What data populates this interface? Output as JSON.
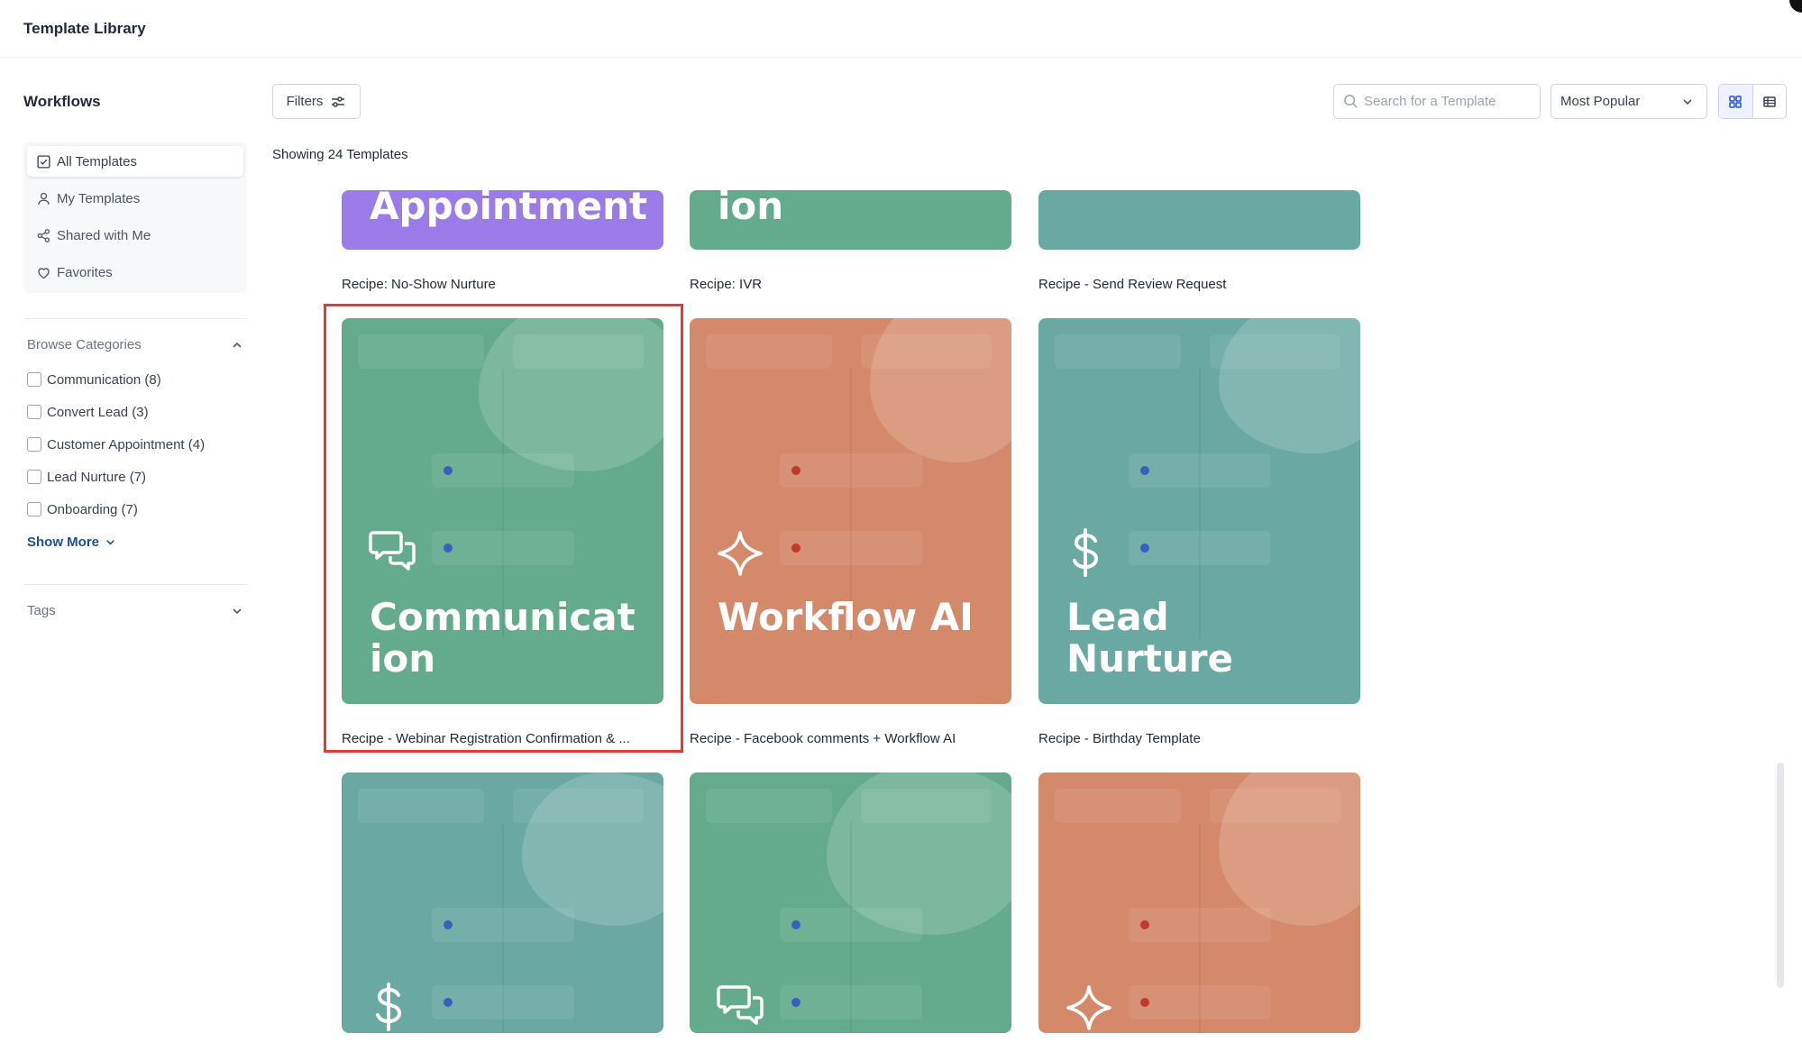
{
  "header": {
    "title": "Template Library"
  },
  "sidebar": {
    "title": "Workflows",
    "nav": [
      {
        "label": "All Templates",
        "icon": "check-square-icon",
        "active": true
      },
      {
        "label": "My Templates",
        "icon": "user-icon",
        "active": false
      },
      {
        "label": "Shared with Me",
        "icon": "share-icon",
        "active": false
      },
      {
        "label": "Favorites",
        "icon": "heart-icon",
        "active": false
      }
    ],
    "browse_categories": {
      "title": "Browse Categories",
      "items": [
        {
          "label": "Communication (8)",
          "checked": false
        },
        {
          "label": "Convert Lead (3)",
          "checked": false
        },
        {
          "label": "Customer Appointment (4)",
          "checked": false
        },
        {
          "label": "Lead Nurture (7)",
          "checked": false
        },
        {
          "label": "Onboarding (7)",
          "checked": false
        }
      ],
      "show_more": "Show More"
    },
    "tags": {
      "title": "Tags"
    }
  },
  "toolbar": {
    "filters_label": "Filters",
    "search_placeholder": "Search for a Template",
    "sort_value": "Most Popular",
    "view_modes": [
      "grid",
      "list"
    ],
    "active_view": "grid"
  },
  "results": {
    "showing_label": "Showing 24 Templates"
  },
  "cards": [
    {
      "title": "Appointment",
      "label": "Recipe: No-Show Nurture",
      "color": "#9b7be8",
      "icon": ""
    },
    {
      "title": "ion",
      "label": "Recipe: IVR",
      "color": "#63ab8c",
      "icon": ""
    },
    {
      "title": "",
      "label": "Recipe - Send Review Request",
      "color": "#6aa9a2",
      "icon": ""
    },
    {
      "title": "Communicat ion",
      "label": "Recipe - Webinar Registration Confirmation & ...",
      "color": "#63ab8c",
      "icon": "chat-bubbles-icon"
    },
    {
      "title": "Workflow AI",
      "label": "Recipe - Facebook comments + Workflow AI",
      "color": "#d4896b",
      "icon": "sparkle-icon"
    },
    {
      "title": "Lead Nurture",
      "label": "Recipe - Birthday Template",
      "color": "#6aa9a2",
      "icon": "dollar-icon"
    },
    {
      "title": "",
      "label": "",
      "color": "#6aa9a2",
      "icon": "dollar-icon"
    },
    {
      "title": "",
      "label": "",
      "color": "#63ab8c",
      "icon": "chat-bubbles-icon"
    },
    {
      "title": "",
      "label": "",
      "color": "#d4896b",
      "icon": "sparkle-icon"
    }
  ],
  "highlighted_card": "Recipe - Webinar Registration Confirmation & ..."
}
